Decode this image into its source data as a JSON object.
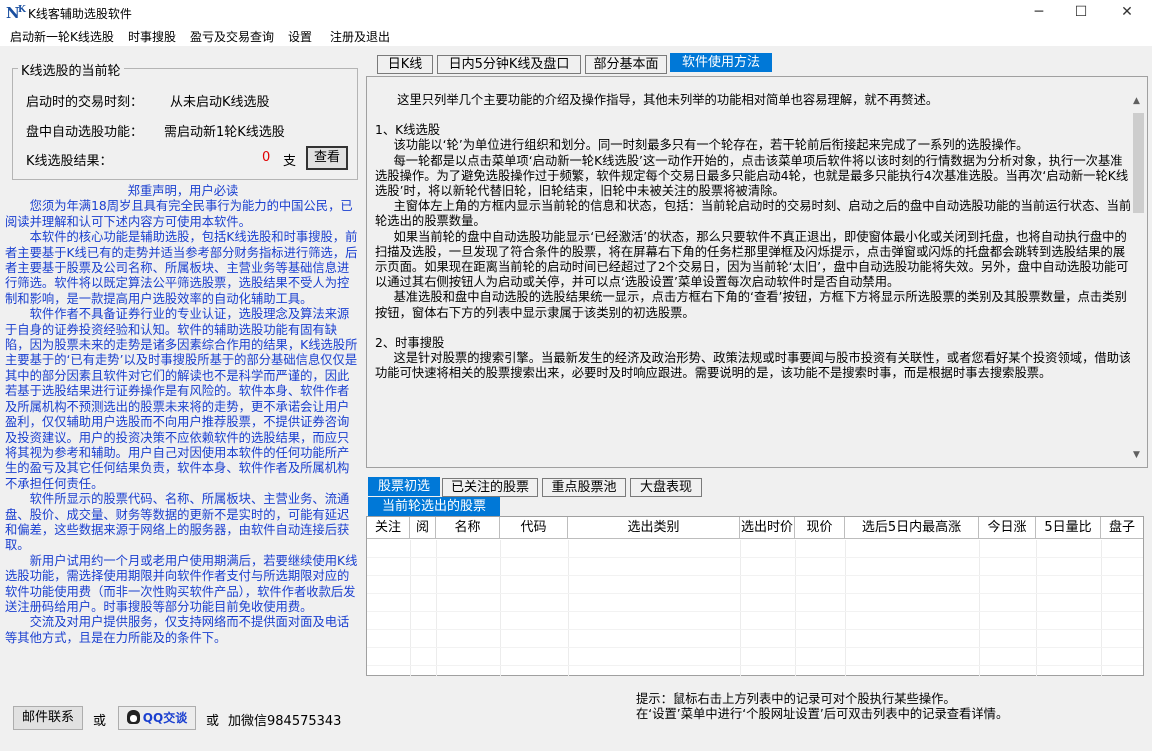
{
  "window": {
    "title": "K线客辅助选股软件",
    "icon_label": "N",
    "icon_superscript": "K",
    "minimize": "─",
    "maximize": "☐",
    "close": "✕"
  },
  "menu": [
    "启动新一轮K线选股",
    "时事搜股",
    "盈亏及交易查询",
    "设置",
    "注册及退出"
  ],
  "current_round": {
    "group_title": "K线选股的当前轮",
    "start_time_label": "启动时的交易时刻：",
    "start_time_value": "从未启动K线选股",
    "auto_label": "盘中自动选股功能：",
    "auto_value": "需启动新1轮K线选股",
    "result_label": "K线选股结果：",
    "result_count": "0",
    "result_unit": "支",
    "view_button": "查看"
  },
  "disclaimer": {
    "title": "郑重声明，用户必读",
    "paragraphs": [
      "您须为年满18周岁且具有完全民事行为能力的中国公民，已阅读并理解和认可下述内容方可使用本软件。",
      "本软件的核心功能是辅助选股，包括K线选股和时事搜股，前者主要基于K线已有的走势并适当参考部分财务指标进行筛选，后者主要基于股票及公司名称、所属板块、主营业务等基础信息进行筛选。软件将以既定算法公平筛选股票，选股结果不受人为控制和影响，是一款提高用户选股效率的自动化辅助工具。",
      "软件作者不具备证券行业的专业认证，选股理念及算法来源于自身的证券投资经验和认知。软件的辅助选股功能有固有缺陷，因为股票未来的走势是诸多因素综合作用的结果，K线选股所主要基于的‘已有走势’以及时事搜股所基于的部分基础信息仅仅是其中的部分因素且软件对它们的解读也不是科学而严谨的，因此若基于选股结果进行证券操作是有风险的。软件本身、软件作者及所属机构不预测选出的股票未来将的走势，更不承诺会让用户盈利，仅仅辅助用户选股而不向用户推荐股票，不提供证券咨询及投资建议。用户的投资决策不应依赖软件的选股结果，而应只将其视为参考和辅助。用户自己对因使用本软件的任何功能所产生的盈亏及其它任何结果负责，软件本身、软件作者及所属机构不承担任何责任。",
      "软件所显示的股票代码、名称、所属板块、主营业务、流通盘、股价、成交量、财务等数据的更新不是实时的，可能有延迟和偏差，这些数据来源于网络上的服务器，由软件自动连接后获取。",
      "新用户试用约一个月或老用户使用期满后，若要继续使用K线选股功能，需选择使用期限并向软件作者支付与所选期限对应的软件功能使用费（而非一次性购买软件产品），软件作者收款后发送注册码给用户。时事搜股等部分功能目前免收使用费。",
      "交流及对用户提供服务，仅支持网络而不提供面对面及电话等其他方式，且是在力所能及的条件下。"
    ]
  },
  "contact": {
    "email_button": "邮件联系",
    "or1": "或",
    "qq_button": "QQ交谈",
    "or2": "或",
    "wechat": "加微信984575343"
  },
  "top_tabs": [
    "日K线",
    "日内5分钟K线及盘口",
    "部分基本面",
    "软件使用方法"
  ],
  "help": {
    "intro": "这里只列举几个主要功能的介绍及操作指导，其他未列举的功能相对简单也容易理解，就不再赘述。",
    "sec1_title": "1、K线选股",
    "sec1_p1": "该功能以‘轮’为单位进行组织和划分。同一时刻最多只有一个轮存在，若干轮前后衔接起来完成了一系列的选股操作。",
    "sec1_p2": "每一轮都是以点击菜单项‘启动新一轮K线选股’这一动作开始的，点击该菜单项后软件将以该时刻的行情数据为分析对象，执行一次基准选股操作。为了避免选股操作过于频繁，软件规定每个交易日最多只能启动4轮，也就是最多只能执行4次基准选股。当再次‘启动新一轮K线选股’时，将以新轮代替旧轮，旧轮结束，旧轮中未被关注的股票将被清除。",
    "sec1_p3": "主窗体左上角的方框内显示当前轮的信息和状态，包括：当前轮启动时的交易时刻、启动之后的盘中自动选股功能的当前运行状态、当前轮选出的股票数量。",
    "sec1_p4": "如果当前轮的盘中自动选股功能显示‘已经激活’的状态，那么只要软件不真正退出，即使窗体最小化或关闭到托盘，也将自动执行盘中的扫描及选股，一旦发现了符合条件的股票，将在屏幕右下角的任务栏那里弹框及闪烁提示，点击弹窗或闪烁的托盘都会跳转到选股结果的展示页面。如果现在距离当前轮的启动时间已经超过了2个交易日，因为当前轮‘太旧’，盘中自动选股功能将失效。另外，盘中自动选股功能可以通过其右侧按钮人为启动或关停，并可以点‘选股设置’菜单设置每次启动软件时是否自动禁用。",
    "sec1_p5": "基准选股和盘中自动选股的选股结果统一显示，点击方框右下角的‘查看’按钮，方框下方将显示所选股票的类别及其股票数量，点击类别按钮，窗体右下方的列表中显示隶属于该类别的初选股票。",
    "sec2_title": "2、时事搜股",
    "sec2_p1": "这是针对股票的搜索引擎。当最新发生的经济及政治形势、政策法规或时事要闻与股市投资有关联性，或者您看好某个投资领域，借助该功能可快速将相关的股票搜索出来，必要时及时响应跟进。需要说明的是，该功能不是搜索时事，而是根据时事去搜索股票。"
  },
  "bottom_tabs": [
    "股票初选",
    "已关注的股票",
    "重点股票池",
    "大盘表现"
  ],
  "sub_tab": "当前轮选出的股票",
  "table": {
    "columns": [
      "关注",
      "阅",
      "名称",
      "代码",
      "选出类别",
      "选出时价",
      "现价",
      "选后5日内最高涨",
      "今日涨",
      "5日量比",
      "盘子"
    ]
  },
  "hint": {
    "line1": "提示：鼠标右击上方列表中的记录可对个股执行某些操作。",
    "line2": "在‘设置’菜单中进行‘个股网址设置’后可双击列表中的记录查看详情。"
  },
  "colors": {
    "accent": "#0078d7",
    "disclaimer_text": "#1a3fd0",
    "count_red": "#e00000"
  }
}
